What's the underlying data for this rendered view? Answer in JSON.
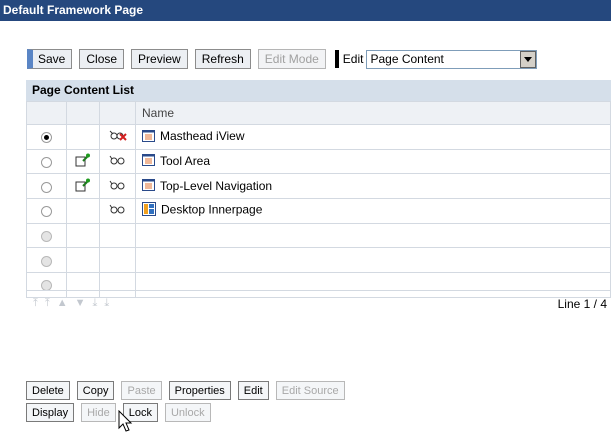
{
  "title": "Default Framework Page",
  "toolbar": {
    "save": "Save",
    "close": "Close",
    "preview": "Preview",
    "refresh": "Refresh",
    "edit_mode": "Edit Mode",
    "edit_label": "Edit",
    "edit_select_value": "Page Content"
  },
  "panel": {
    "title": "Page Content List",
    "column_name": "Name",
    "rows": [
      {
        "name": "Masthead iView",
        "selected": true,
        "pinned": false,
        "icon": "iview-icon",
        "glasses": "glasses-crossed-icon"
      },
      {
        "name": "Tool Area",
        "selected": false,
        "pinned": true,
        "icon": "iview-icon",
        "glasses": "glasses-icon"
      },
      {
        "name": "Top-Level Navigation",
        "selected": false,
        "pinned": true,
        "icon": "iview-icon",
        "glasses": "glasses-icon"
      },
      {
        "name": "Desktop Innerpage",
        "selected": false,
        "pinned": false,
        "icon": "page-icon",
        "glasses": "glasses-icon"
      }
    ],
    "empty_rows": 3,
    "line_info": "Line 1 / 4"
  },
  "actions_row1": {
    "delete": "Delete",
    "copy": "Copy",
    "paste": "Paste",
    "properties": "Properties",
    "edit": "Edit",
    "edit_source": "Edit Source"
  },
  "actions_row2": {
    "display": "Display",
    "hide": "Hide",
    "lock": "Lock",
    "unlock": "Unlock"
  }
}
